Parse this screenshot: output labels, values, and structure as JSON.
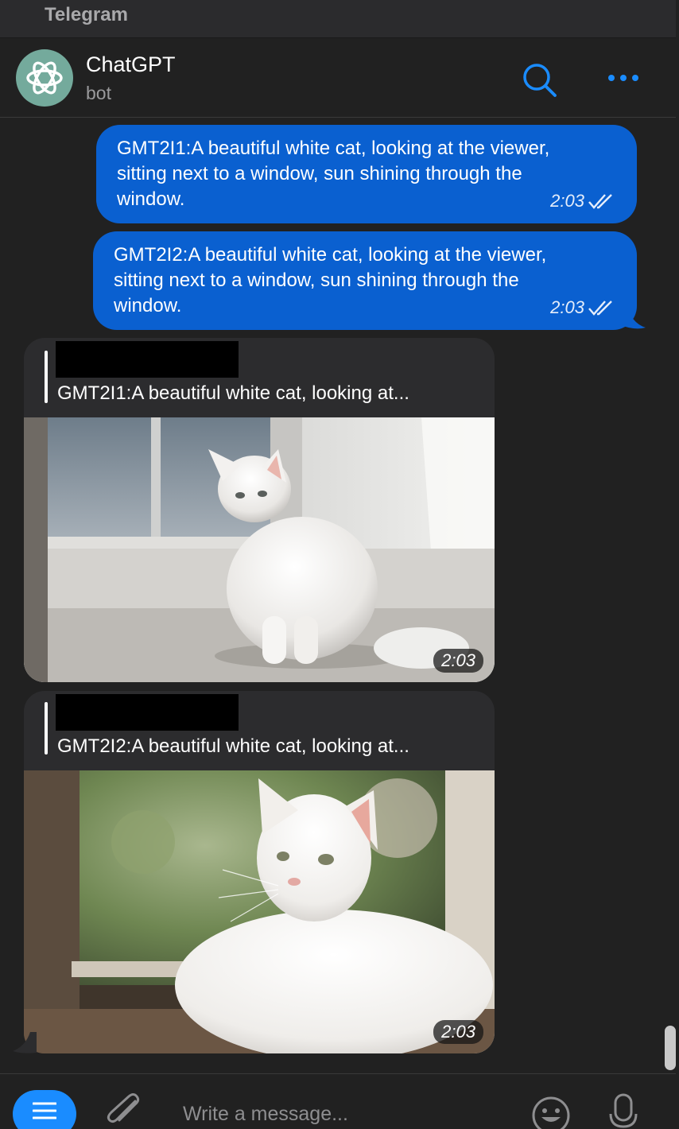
{
  "window": {
    "title": "Telegram"
  },
  "header": {
    "chat_name": "ChatGPT",
    "status": "bot",
    "accent": "#1a8cff",
    "icons": [
      "chatgpt-logo",
      "search-icon",
      "more-icon"
    ]
  },
  "messages": [
    {
      "direction": "outgoing",
      "text": "GMT2I1:A beautiful white cat, looking at the viewer,\nsitting next to a window, sun shining through the\nwindow.",
      "time": "2:03",
      "read": true
    },
    {
      "direction": "outgoing",
      "text": "GMT2I2:A beautiful white cat, looking at the viewer,\nsitting next to a window, sun shining through the\nwindow.",
      "time": "2:03",
      "read": true
    },
    {
      "direction": "incoming",
      "reply_preview": "GMT2I1:A beautiful white cat, looking at...",
      "photo": "white cat sitting on a windowsill in sunlight",
      "time": "2:03"
    },
    {
      "direction": "incoming",
      "reply_preview": "GMT2I2:A beautiful white cat, looking at...",
      "photo": "white cat lying by a window with a green garden behind",
      "time": "2:03"
    }
  ],
  "composer": {
    "placeholder": "Write a message...",
    "icons": [
      "menu-icon",
      "attach-icon",
      "emoji-icon",
      "mic-icon"
    ]
  },
  "colors": {
    "background": "#212121",
    "outgoing_bubble": "#0a60d0",
    "incoming_bubble": "#2c2c2e"
  }
}
